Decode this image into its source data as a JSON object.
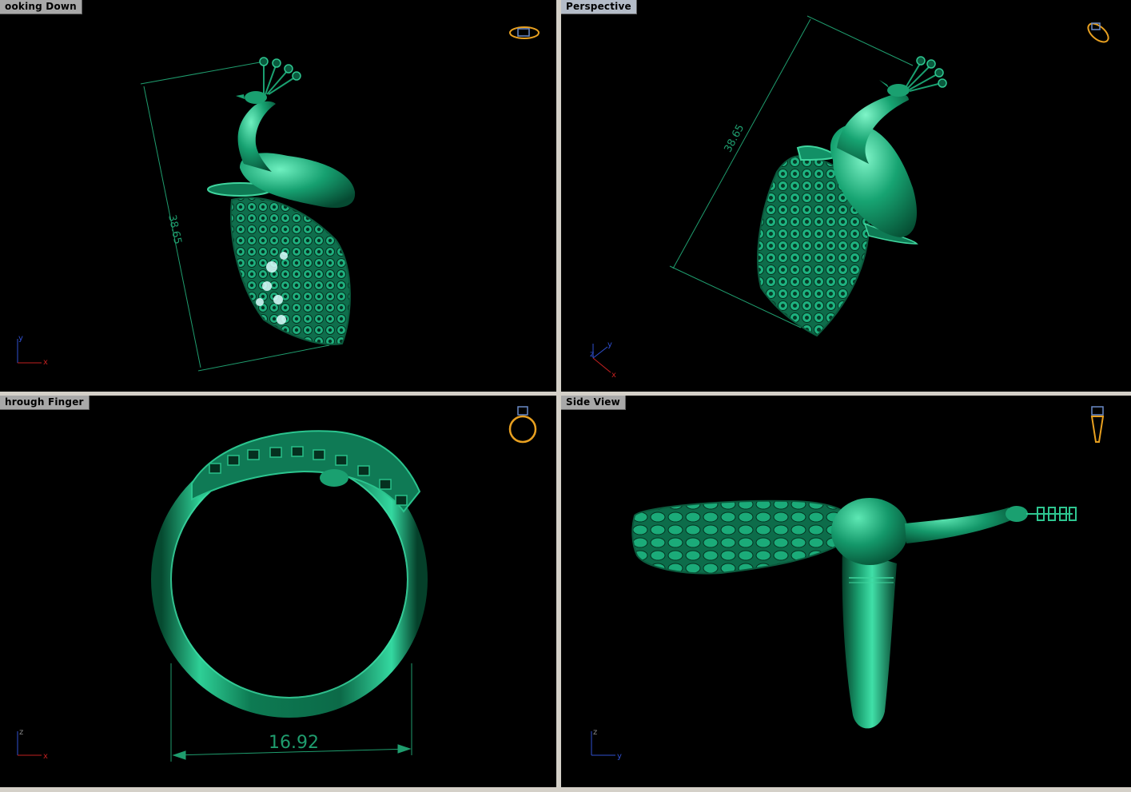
{
  "viewports": {
    "top_left": {
      "title": "ooking Down",
      "dimension": "38.65",
      "axes": {
        "a": "y",
        "b": "x"
      }
    },
    "top_right": {
      "title": "Perspective",
      "dimension": "38.65",
      "axes": {
        "a": "z",
        "b": "y",
        "c": "x"
      }
    },
    "bottom_left": {
      "title": "hrough Finger",
      "dimension": "16.92",
      "axes": {
        "a": "z",
        "b": "x"
      }
    },
    "bottom_right": {
      "title": "Side View",
      "axes": {
        "a": "z",
        "b": "y"
      }
    }
  },
  "colors": {
    "model": "#1a8a64",
    "model_light": "#5fe0b4",
    "dimension": "#1f9d6e",
    "background": "#000000",
    "icon": "#e8a020"
  }
}
